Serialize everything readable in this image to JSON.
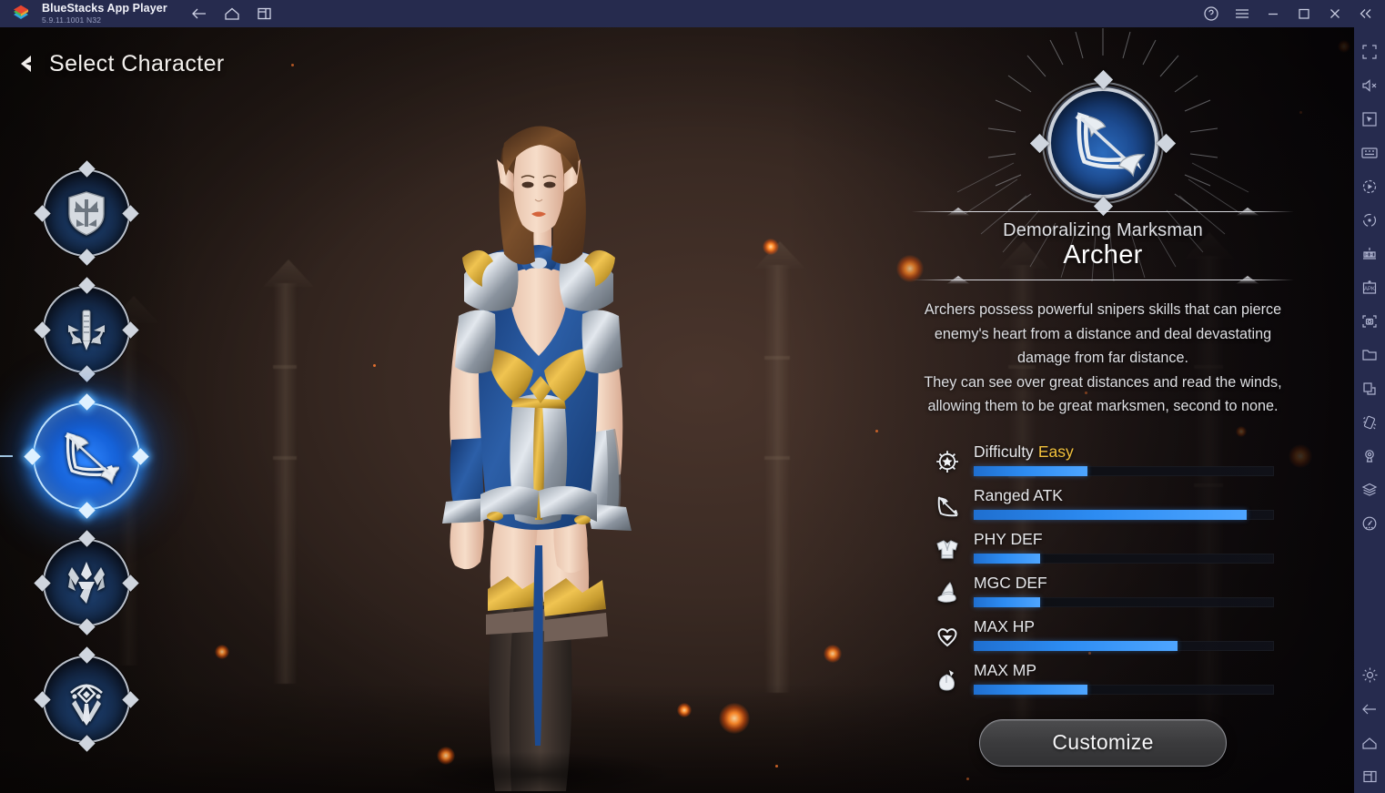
{
  "titlebar": {
    "app_name": "BlueStacks App Player",
    "version": "5.9.11.1001  N32",
    "nav": [
      {
        "name": "back-arrow-icon",
        "label": "Back"
      },
      {
        "name": "home-icon",
        "label": "Home"
      },
      {
        "name": "multi-instance-icon",
        "label": "Multi-instance"
      }
    ],
    "window_controls": [
      {
        "name": "help-icon",
        "label": "Help"
      },
      {
        "name": "menu-icon",
        "label": "Menu"
      },
      {
        "name": "minimize-icon",
        "label": "Minimize"
      },
      {
        "name": "maximize-icon",
        "label": "Maximize"
      },
      {
        "name": "close-icon",
        "label": "Close"
      },
      {
        "name": "collapse-sidebar-icon",
        "label": "Collapse sidebar"
      }
    ]
  },
  "toolbar": {
    "items": [
      {
        "name": "fullscreen-icon",
        "label": "Full screen"
      },
      {
        "name": "mute-icon",
        "label": "Mute"
      },
      {
        "name": "cursor-pointer-icon",
        "label": "Pointer"
      },
      {
        "name": "keyboard-controls-icon",
        "label": "Game controls"
      },
      {
        "name": "macro-recorder-icon",
        "label": "Macro recorder"
      },
      {
        "name": "rotate-icon",
        "label": "Rotate"
      },
      {
        "name": "multi-instance-manager-icon",
        "label": "Multi-instance manager"
      },
      {
        "name": "install-apk-icon",
        "label": "Install APK"
      },
      {
        "name": "screenshot-icon",
        "label": "Screenshot"
      },
      {
        "name": "media-manager-icon",
        "label": "Media manager"
      },
      {
        "name": "copy-paste-icon",
        "label": "Copy to/from"
      },
      {
        "name": "shake-icon",
        "label": "Shake"
      },
      {
        "name": "location-icon",
        "label": "Location"
      },
      {
        "name": "layers-icon",
        "label": "Layers"
      },
      {
        "name": "disk-cleanup-icon",
        "label": "Disk cleanup"
      }
    ],
    "bottom_items": [
      {
        "name": "settings-gear-icon",
        "label": "Settings"
      },
      {
        "name": "back-arrow-icon",
        "label": "Back"
      },
      {
        "name": "home-icon",
        "label": "Home"
      },
      {
        "name": "recents-icon",
        "label": "Recent apps"
      }
    ]
  },
  "game": {
    "page_title": "Select Character",
    "back_button_label": "Back",
    "class_rail": [
      {
        "name": "class-warrior",
        "glyph": "shield-sword-icon",
        "selected": false
      },
      {
        "name": "class-knight",
        "glyph": "greatsword-icon",
        "selected": false
      },
      {
        "name": "class-archer",
        "glyph": "bow-arrow-icon",
        "selected": true
      },
      {
        "name": "class-mage",
        "glyph": "crown-spike-icon",
        "selected": false
      },
      {
        "name": "class-assassin",
        "glyph": "rune-dagger-icon",
        "selected": false
      }
    ],
    "info": {
      "emblem_icon": "bow-arrow-icon",
      "subtitle": "Demoralizing Marksman",
      "name": "Archer",
      "description": "Archers possess powerful snipers skills that can pierce enemy's heart from a distance and deal devastating damage from far distance.\nThey can see over great distances and read the winds, allowing them to be great marksmen, second to none.",
      "stats": [
        {
          "name": "stat-difficulty",
          "icon": "compass-star-icon",
          "label": "Difficulty",
          "value": "Easy",
          "fill_pct": 38
        },
        {
          "name": "stat-ranged-atk",
          "icon": "bow-icon",
          "label": "Ranged ATK",
          "value": "",
          "fill_pct": 91
        },
        {
          "name": "stat-phy-def",
          "icon": "armor-shirt-icon",
          "label": "PHY DEF",
          "value": "",
          "fill_pct": 22
        },
        {
          "name": "stat-mgc-def",
          "icon": "wizard-hat-icon",
          "label": "MGC DEF",
          "value": "",
          "fill_pct": 22
        },
        {
          "name": "stat-max-hp",
          "icon": "heart-icon",
          "label": "MAX HP",
          "value": "",
          "fill_pct": 68
        },
        {
          "name": "stat-max-mp",
          "icon": "potion-flask-icon",
          "label": "MAX MP",
          "value": "",
          "fill_pct": 38
        }
      ],
      "customize_label": "Customize"
    },
    "colors": {
      "accent_blue": "#2d8cf2",
      "highlight_yellow": "#f2c13c",
      "bar_track": "#101219",
      "panel_text": "#dedfe3",
      "bluestacks_chrome": "#262b4e"
    }
  }
}
